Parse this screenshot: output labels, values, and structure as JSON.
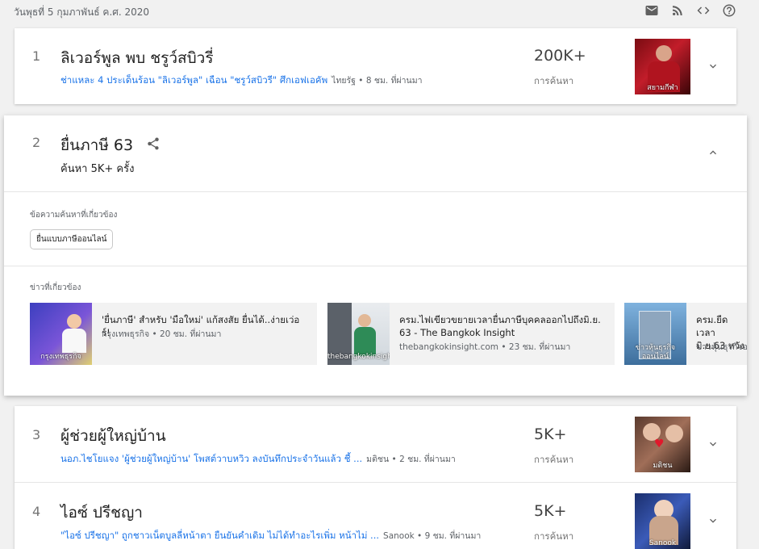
{
  "header": {
    "date": "วันพุธที่ 5 กุมภาพันธ์ ค.ศ. 2020",
    "icons": [
      "mail-icon",
      "rss-icon",
      "embed-code-icon",
      "help-icon"
    ]
  },
  "trends": [
    {
      "rank": "1",
      "title": "ลิเวอร์พูล พบ ชรูว์สบิวรี่",
      "article": "ช่าแหละ 4 ประเด็นร้อน \"ลิเวอร์พูล\" เฉือน \"ชรูว์สบิวรี\" ศึกเอฟเอคัพ",
      "source_time": "ไทยรัฐ • 8 ชม. ที่ผ่านมา",
      "count": "200K+",
      "count_label": "การค้นหา",
      "thumb_caption": "สยามกีฬา"
    },
    {
      "rank": "2",
      "title": "ยื่นภาษี 63",
      "searches": "ค้นหา 5K+ ครั้ง",
      "related_queries_label": "ข้อความค้นหาที่เกี่ยวข้อง",
      "related_queries": [
        "ยื่นแบบภาษีออนไลน์"
      ],
      "related_news_label": "ข่าวที่เกี่ยวข้อง",
      "news": [
        {
          "title": "'ยื่นภาษี' สำหรับ 'มือใหม่' แก้สงสัย ยื่นได้..ง่ายเว่อร์!",
          "meta": "กรุงเทพธุรกิจ • 20 ชม. ที่ผ่านมา",
          "image_caption": "กรุงเทพธุรกิจ"
        },
        {
          "title": "ครม.ไฟเขียวขยายเวลายื่นภาษีบุคคลออกไปถึงมิ.ย. 63 - The Bangkok Insight",
          "meta": "thebangkokinsight.com • 23 ชม. ที่ผ่านมา",
          "image_caption": "thebangkokinsight.com"
        },
        {
          "title": "ครม.ยืดเวลา มิ.ย.63 หวัง",
          "meta": "ข่าวหุ้นธุรกิจอ",
          "image_caption": "ข่าวหุ้นธุรกิจ ออนไลน์"
        }
      ]
    },
    {
      "rank": "3",
      "title": "ผู้ช่วยผู้ใหญ่บ้าน",
      "article": "นอภ.ไชโยแจง 'ผู้ช่วยผู้ใหญ่บ้าน' โพสต์วาบหวิว ลงบันทึกประจำวันแล้ว ชี้ ...",
      "source_time": "มติชน • 2 ชม. ที่ผ่านมา",
      "count": "5K+",
      "count_label": "การค้นหา",
      "thumb_caption": "มติชน"
    },
    {
      "rank": "4",
      "title": "ไอซ์ ปรีชญา",
      "article": "\"ไอซ์ ปรีชญา\" ถูกชาวเน็ตบูลลี่หน้าตา ยืนยันคำเดิม ไม่ได้ทำอะไรเพิ่ม หน้าไม่ ...",
      "source_time": "Sanook • 9 ชม. ที่ผ่านมา",
      "count": "5K+",
      "count_label": "การค้นหา",
      "thumb_caption": "Sanook"
    }
  ],
  "colors": {
    "link": "#1a73e8",
    "background": "#f1f1f1",
    "card": "#ffffff"
  }
}
